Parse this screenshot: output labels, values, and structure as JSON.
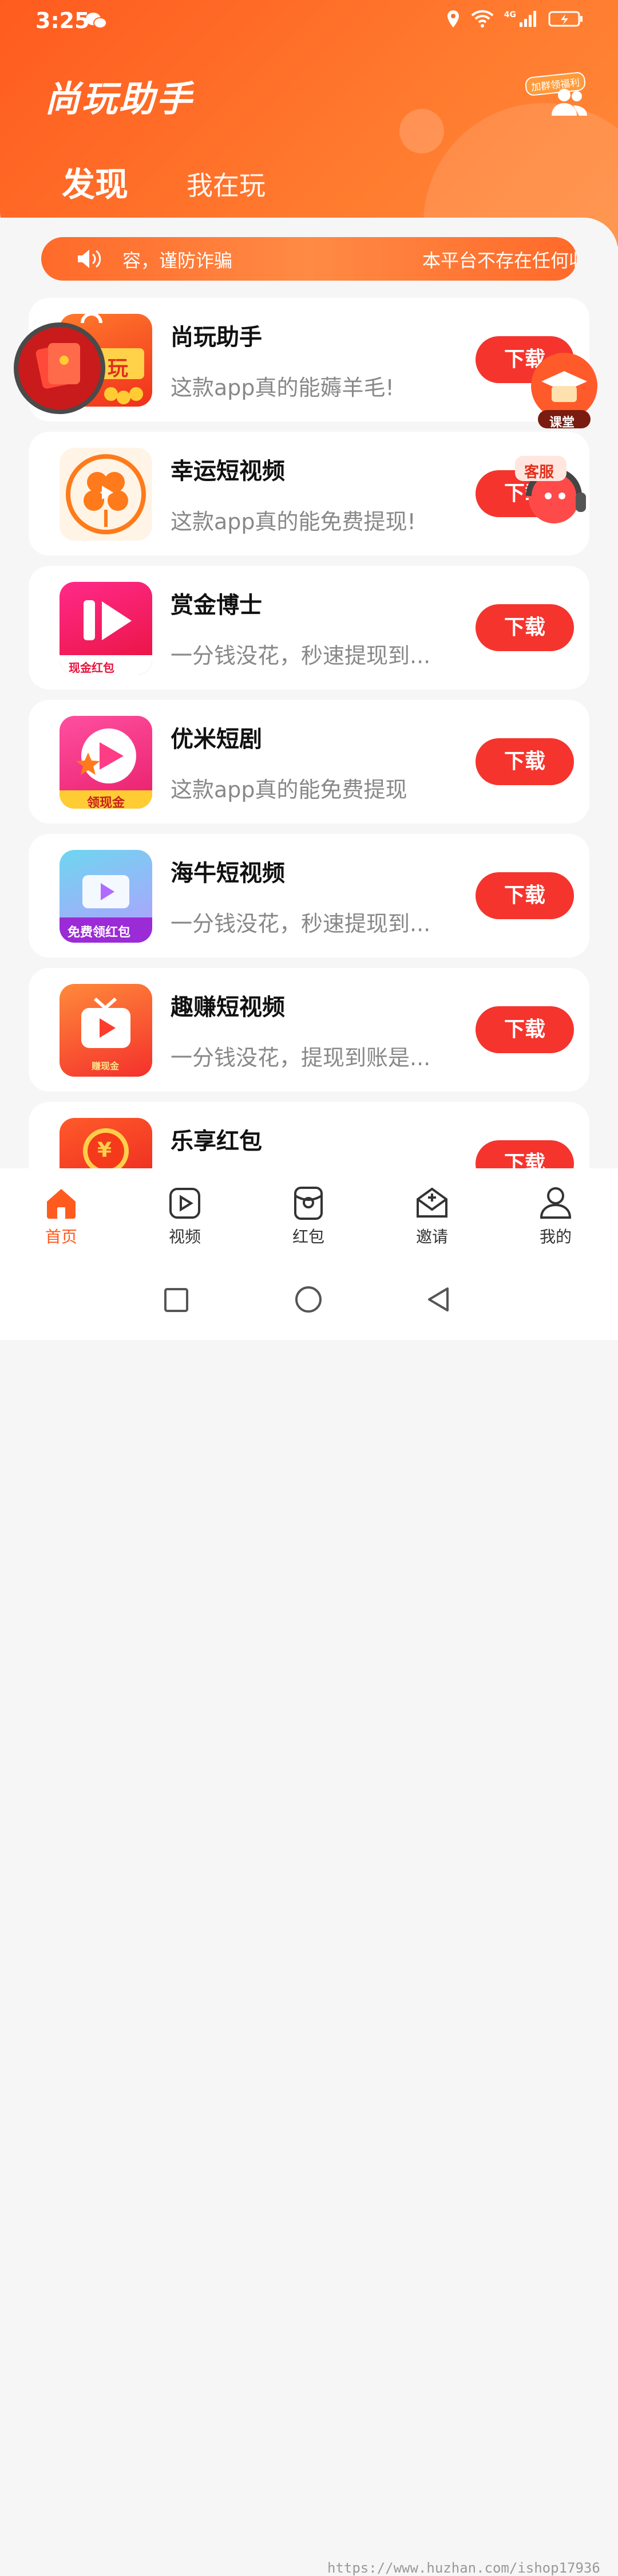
{
  "status_bar": {
    "time": "3:25",
    "network": "4G"
  },
  "header": {
    "brand": "尚玩助手",
    "group_badge": "加群领福利",
    "tabs": [
      {
        "label": "发现",
        "active": true
      },
      {
        "label": "我在玩",
        "active": false
      }
    ]
  },
  "notice": {
    "left_text": "容，谨防诈骗",
    "right_text": "本平台不存在任何收"
  },
  "apps": [
    {
      "name": "尚玩助手",
      "desc": "这款app真的能薅羊毛!",
      "button": "下载",
      "icon_label": "玩"
    },
    {
      "name": "幸运短视频",
      "desc": "这款app真的能免费提现!",
      "button": "下载",
      "icon_label": ""
    },
    {
      "name": "赏金博士",
      "desc": "一分钱没花，秒速提现到...",
      "button": "下载",
      "icon_label": "现金红包"
    },
    {
      "name": "优米短剧",
      "desc": "这款app真的能免费提现",
      "button": "下载",
      "icon_label": "领现金"
    },
    {
      "name": "海牛短视频",
      "desc": "一分钱没花，秒速提现到...",
      "button": "下载",
      "icon_label": "免费领红包"
    },
    {
      "name": "趣赚短视频",
      "desc": "一分钱没花，提现到账是...",
      "button": "下载",
      "icon_label": "赚现金"
    },
    {
      "name": "乐享红包",
      "desc": "",
      "button": "下载",
      "icon_label": "¥"
    }
  ],
  "floating": {
    "class_label": "课堂",
    "service_label": "客服"
  },
  "tabbar": [
    {
      "label": "首页",
      "active": true
    },
    {
      "label": "视频",
      "active": false
    },
    {
      "label": "红包",
      "active": false
    },
    {
      "label": "邀请",
      "active": false
    },
    {
      "label": "我的",
      "active": false
    }
  ],
  "watermark": "https://www.huzhan.com/ishop17936",
  "colors": {
    "accent": "#ff5b1f",
    "button": "#f5342d",
    "active_tab": "#ff5b1f"
  }
}
